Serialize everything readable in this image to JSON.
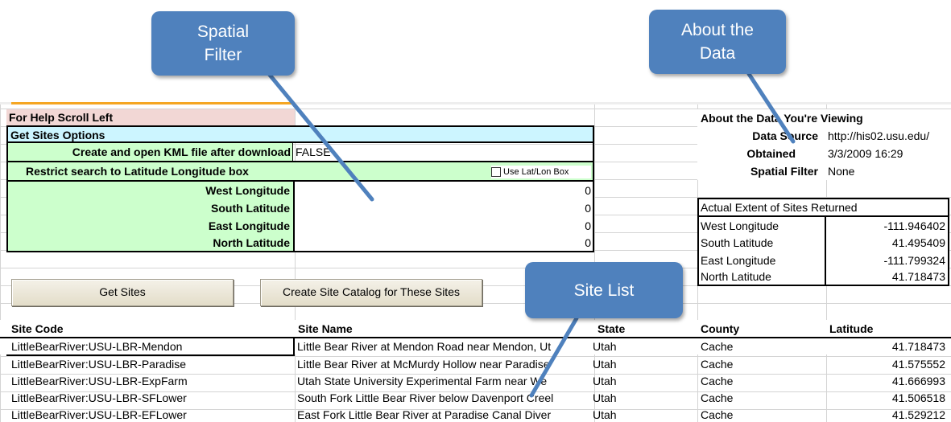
{
  "callouts": {
    "spatial_filter": "Spatial\nFilter",
    "about_data": "About the\nData",
    "site_list": "Site List"
  },
  "panel": {
    "help": "For Help Scroll Left",
    "get_sites_options": "Get Sites Options",
    "kml_label": "Create and open KML file after download",
    "kml_value": "FALSE",
    "restrict_label": "Restrict search to Latitude Longitude box",
    "use_latlon_label": "Use Lat/Lon Box",
    "west_label": "West Longitude",
    "south_label": "South Latitude",
    "east_label": "East Longitude",
    "north_label": "North Latitude",
    "west_value": "0",
    "south_value": "0",
    "east_value": "0",
    "north_value": "0"
  },
  "buttons": {
    "get_sites": "Get Sites",
    "create_catalog": "Create Site Catalog for These Sites"
  },
  "about": {
    "title": "About the Data You're Viewing",
    "source_label": "Data Source",
    "source_value": "http://his02.usu.edu/",
    "obtained_label": "Obtained",
    "obtained_value": "3/3/2009 16:29",
    "spatial_label": "Spatial Filter",
    "spatial_value": "None"
  },
  "extent": {
    "title": "Actual Extent of Sites Returned",
    "west_label": "West Longitude",
    "west_value": "-111.946402",
    "south_label": "South Latitude",
    "south_value": "41.495409",
    "east_label": "East Longitude",
    "east_value": "-111.799324",
    "north_label": "North Latitude",
    "north_value": "41.718473"
  },
  "table": {
    "headers": {
      "site_code": "Site Code",
      "site_name": "Site Name",
      "state": "State",
      "county": "County",
      "latitude": "Latitude"
    },
    "rows": [
      {
        "code": "LittleBearRiver:USU-LBR-Mendon",
        "name": "Little Bear River at Mendon Road near Mendon, Ut",
        "state": "Utah",
        "county": "Cache",
        "lat": "41.718473"
      },
      {
        "code": "LittleBearRiver:USU-LBR-Paradise",
        "name": "Little Bear River at McMurdy Hollow near Paradise",
        "state": "Utah",
        "county": "Cache",
        "lat": "41.575552"
      },
      {
        "code": "LittleBearRiver:USU-LBR-ExpFarm",
        "name": "Utah State University Experimental Farm near We",
        "state": "Utah",
        "county": "Cache",
        "lat": "41.666993"
      },
      {
        "code": "LittleBearRiver:USU-LBR-SFLower",
        "name": "South Fork Little Bear River below Davenport Creel",
        "state": "Utah",
        "county": "Cache",
        "lat": "41.506518"
      },
      {
        "code": "LittleBearRiver:USU-LBR-EFLower",
        "name": "East Fork Little Bear River at Paradise Canal Diver",
        "state": "Utah",
        "county": "Cache",
        "lat": "41.529212"
      }
    ]
  }
}
